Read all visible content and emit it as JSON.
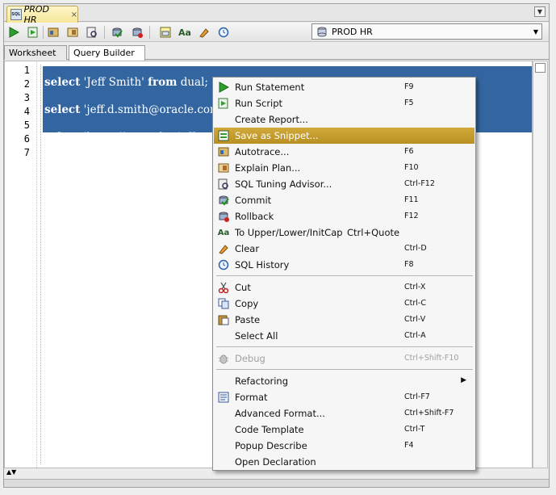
{
  "tab": {
    "title": "PROD HR",
    "close": "×",
    "icon_text": "SQL"
  },
  "connection": {
    "name": "PROD HR"
  },
  "subtabs": [
    "Worksheet",
    "Query Builder"
  ],
  "line_numbers": [
    "1",
    "2",
    "3",
    "4",
    "5",
    "6",
    "7"
  ],
  "code": {
    "line2_kw1": "select",
    "line2_str": "'Jeff Smith'",
    "line2_kw2": "from",
    "line2_rest": "dual;",
    "line4_kw1": "select",
    "line4_str": "'jeff.d.smith@oracle.com",
    "line6_kw1": "select",
    "line6_str": "'htttp://www.thatjeffsmit"
  },
  "menu": {
    "run_statement": {
      "label": "Run Statement",
      "shortcut": "F9"
    },
    "run_script": {
      "label": "Run Script",
      "shortcut": "F5"
    },
    "create_report": {
      "label": "Create Report...",
      "shortcut": ""
    },
    "save_snippet": {
      "label": "Save as Snippet...",
      "shortcut": ""
    },
    "autotrace": {
      "label": "Autotrace...",
      "shortcut": "F6"
    },
    "explain_plan": {
      "label": "Explain Plan...",
      "shortcut": "F10"
    },
    "sql_tuning": {
      "label": "SQL Tuning Advisor...",
      "shortcut": "Ctrl-F12"
    },
    "commit": {
      "label": "Commit",
      "shortcut": "F11"
    },
    "rollback": {
      "label": "Rollback",
      "shortcut": "F12"
    },
    "case": {
      "label": "To Upper/Lower/InitCap",
      "shortcut": "Ctrl+Quote"
    },
    "clear": {
      "label": "Clear",
      "shortcut": "Ctrl-D"
    },
    "sql_history": {
      "label": "SQL History",
      "shortcut": "F8"
    },
    "cut": {
      "label": "Cut",
      "shortcut": "Ctrl-X"
    },
    "copy": {
      "label": "Copy",
      "shortcut": "Ctrl-C"
    },
    "paste": {
      "label": "Paste",
      "shortcut": "Ctrl-V"
    },
    "select_all": {
      "label": "Select All",
      "shortcut": "Ctrl-A"
    },
    "debug": {
      "label": "Debug",
      "shortcut": "Ctrl+Shift-F10"
    },
    "refactoring": {
      "label": "Refactoring",
      "shortcut": ""
    },
    "format": {
      "label": "Format",
      "shortcut": "Ctrl-F7"
    },
    "advanced_format": {
      "label": "Advanced Format...",
      "shortcut": "Ctrl+Shift-F7"
    },
    "code_template": {
      "label": "Code Template",
      "shortcut": "Ctrl-T"
    },
    "popup_describe": {
      "label": "Popup Describe",
      "shortcut": "F4"
    },
    "open_declaration": {
      "label": "Open Declaration",
      "shortcut": ""
    }
  },
  "colors": {
    "selection": "#3366a0",
    "highlight": "#c9a23a",
    "tab": "#f6e79a"
  }
}
